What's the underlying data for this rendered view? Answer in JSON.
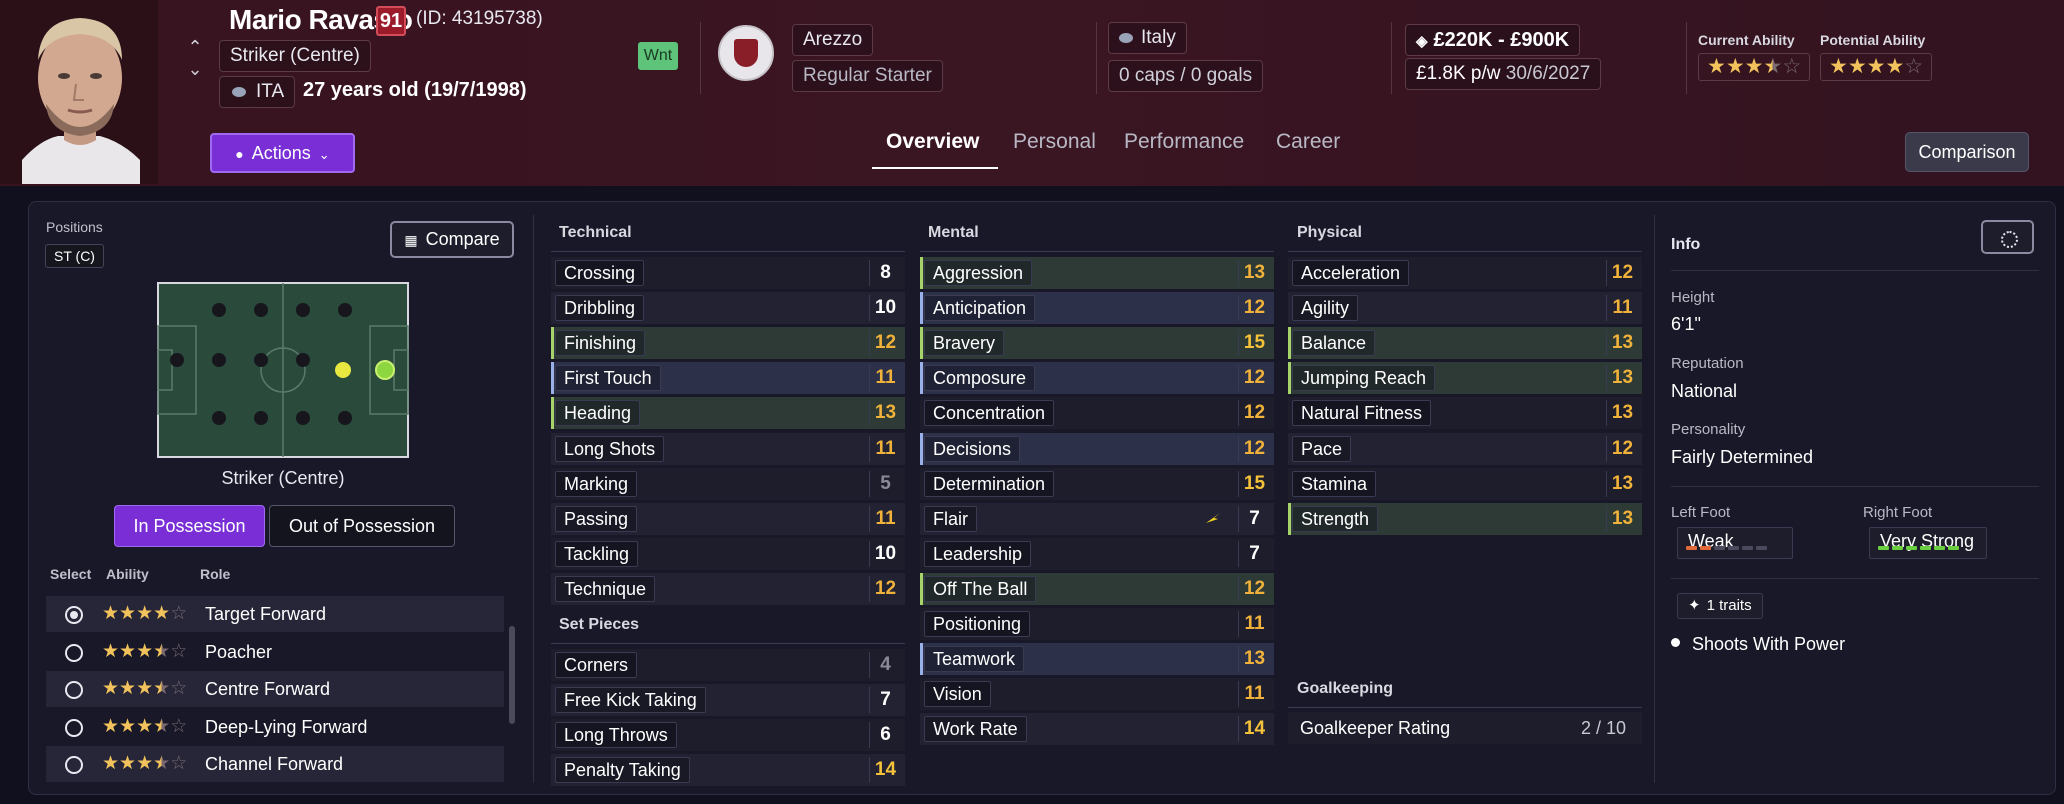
{
  "player": {
    "name": "Mario Ravasio",
    "rating": "91",
    "id": "(ID: 43195738)",
    "position": "Striker (Centre)",
    "nation_code": "ITA",
    "age": "27 years old (19/7/1998)",
    "wnt": "Wnt",
    "club": "Arezzo",
    "squad_role": "Regular Starter",
    "intl_nation": "Italy",
    "caps": "0 caps / 0 goals",
    "value": "£220K - £900K",
    "wage": "£1.8K p/w",
    "contract_end": "30/6/2027",
    "current_ability_label": "Current Ability",
    "potential_ability_label": "Potential Ability",
    "current_ability_stars": 3.5,
    "potential_ability_stars": 4
  },
  "toolbar": {
    "actions_label": "Actions",
    "comparison_label": "Comparison"
  },
  "tabs": [
    "Overview",
    "Personal",
    "Performance",
    "Career"
  ],
  "positions": {
    "label": "Positions",
    "pill": "ST (C)",
    "compare_label": "Compare",
    "pitch_caption": "Striker (Centre)",
    "in_possession": "In Possession",
    "out_possession": "Out of Possession",
    "headers": [
      "Select",
      "Ability",
      "Role"
    ],
    "roles": [
      {
        "name": "Target Forward",
        "stars": 4,
        "selected": true
      },
      {
        "name": "Poacher",
        "stars": 3.5,
        "selected": false
      },
      {
        "name": "Centre Forward",
        "stars": 3.5,
        "selected": false
      },
      {
        "name": "Deep-Lying Forward",
        "stars": 3.5,
        "selected": false
      },
      {
        "name": "Channel Forward",
        "stars": 3.5,
        "selected": false
      }
    ]
  },
  "technical": {
    "title": "Technical",
    "attrs": [
      {
        "name": "Crossing",
        "value": "8",
        "color": "white",
        "hl": ""
      },
      {
        "name": "Dribbling",
        "value": "10",
        "color": "white",
        "hl": ""
      },
      {
        "name": "Finishing",
        "value": "12",
        "color": "orange",
        "hl": "green"
      },
      {
        "name": "First Touch",
        "value": "11",
        "color": "orange",
        "hl": "blue"
      },
      {
        "name": "Heading",
        "value": "13",
        "color": "orange",
        "hl": "green"
      },
      {
        "name": "Long Shots",
        "value": "11",
        "color": "orange",
        "hl": ""
      },
      {
        "name": "Marking",
        "value": "5",
        "color": "grey",
        "hl": ""
      },
      {
        "name": "Passing",
        "value": "11",
        "color": "orange",
        "hl": ""
      },
      {
        "name": "Tackling",
        "value": "10",
        "color": "white",
        "hl": ""
      },
      {
        "name": "Technique",
        "value": "12",
        "color": "orange",
        "hl": ""
      }
    ]
  },
  "set_pieces": {
    "title": "Set Pieces",
    "attrs": [
      {
        "name": "Corners",
        "value": "4",
        "color": "grey",
        "hl": ""
      },
      {
        "name": "Free Kick Taking",
        "value": "7",
        "color": "white",
        "hl": ""
      },
      {
        "name": "Long Throws",
        "value": "6",
        "color": "white",
        "hl": ""
      },
      {
        "name": "Penalty Taking",
        "value": "14",
        "color": "yellow",
        "hl": ""
      }
    ]
  },
  "mental": {
    "title": "Mental",
    "attrs": [
      {
        "name": "Aggression",
        "value": "13",
        "color": "orange",
        "hl": "green"
      },
      {
        "name": "Anticipation",
        "value": "12",
        "color": "orange",
        "hl": "blue"
      },
      {
        "name": "Bravery",
        "value": "15",
        "color": "yellow",
        "hl": "green"
      },
      {
        "name": "Composure",
        "value": "12",
        "color": "orange",
        "hl": "blue"
      },
      {
        "name": "Concentration",
        "value": "12",
        "color": "orange",
        "hl": ""
      },
      {
        "name": "Decisions",
        "value": "12",
        "color": "orange",
        "hl": "blue"
      },
      {
        "name": "Determination",
        "value": "15",
        "color": "yellow",
        "hl": ""
      },
      {
        "name": "Flair",
        "value": "7",
        "color": "white",
        "hl": "",
        "flag": true
      },
      {
        "name": "Leadership",
        "value": "7",
        "color": "white",
        "hl": ""
      },
      {
        "name": "Off The Ball",
        "value": "12",
        "color": "orange",
        "hl": "green"
      },
      {
        "name": "Positioning",
        "value": "11",
        "color": "orange",
        "hl": ""
      },
      {
        "name": "Teamwork",
        "value": "13",
        "color": "orange",
        "hl": "blue"
      },
      {
        "name": "Vision",
        "value": "11",
        "color": "orange",
        "hl": ""
      },
      {
        "name": "Work Rate",
        "value": "14",
        "color": "yellow",
        "hl": ""
      }
    ]
  },
  "physical": {
    "title": "Physical",
    "attrs": [
      {
        "name": "Acceleration",
        "value": "12",
        "color": "orange",
        "hl": ""
      },
      {
        "name": "Agility",
        "value": "11",
        "color": "orange",
        "hl": ""
      },
      {
        "name": "Balance",
        "value": "13",
        "color": "orange",
        "hl": "green"
      },
      {
        "name": "Jumping Reach",
        "value": "13",
        "color": "orange",
        "hl": "green"
      },
      {
        "name": "Natural Fitness",
        "value": "13",
        "color": "orange",
        "hl": ""
      },
      {
        "name": "Pace",
        "value": "12",
        "color": "orange",
        "hl": ""
      },
      {
        "name": "Stamina",
        "value": "13",
        "color": "orange",
        "hl": ""
      },
      {
        "name": "Strength",
        "value": "13",
        "color": "orange",
        "hl": "green"
      }
    ]
  },
  "goalkeeping": {
    "title": "Goalkeeping",
    "rating_label": "Goalkeeper Rating",
    "rating_value": "2 / 10"
  },
  "info": {
    "title": "Info",
    "height_label": "Height",
    "height": "6'1\"",
    "reputation_label": "Reputation",
    "reputation": "National",
    "personality_label": "Personality",
    "personality": "Fairly Determined",
    "left_foot_label": "Left Foot",
    "left_foot": "Weak",
    "left_foot_level": 2,
    "right_foot_label": "Right Foot",
    "right_foot": "Very Strong",
    "right_foot_level": 6,
    "traits_count": "1 traits",
    "trait": "Shoots With Power"
  },
  "colors": {
    "accent": "#7a2fd6",
    "header_bg": "#38141f",
    "good_green": "#a6d46a",
    "value_orange": "#f0b23a"
  }
}
